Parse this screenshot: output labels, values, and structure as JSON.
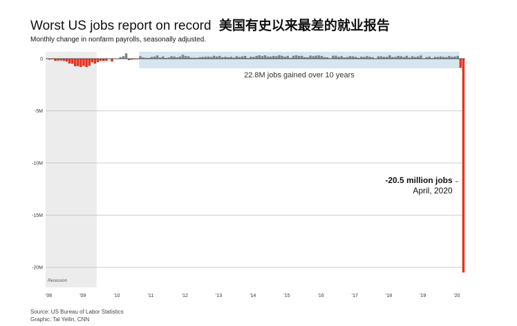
{
  "title": "Worst US jobs report on record",
  "title_cn": "美国有史以来最差的就业报告",
  "subtitle": "Monthly change in nonfarm payrolls, seasonally adjusted.",
  "source": "Source: US Bureau of Labor Statistics",
  "credit": "Graphic: Tal Yellin, CNN",
  "colors": {
    "negative": "#e8321e",
    "positive": "#808689",
    "recession_band": "#ececec",
    "gain_band": "#d6e6ef",
    "grid": "#bdbdbd"
  },
  "chart_data": {
    "type": "bar",
    "x_unit": "month",
    "x_start": "2008-01",
    "x_end": "2020-04",
    "ylabel": "",
    "ylim": [
      -21.0,
      0.6
    ],
    "y_ticks": [
      {
        "value": 0,
        "label": "0"
      },
      {
        "value": -5,
        "label": "-5M"
      },
      {
        "value": -10,
        "label": "-10M"
      },
      {
        "value": -15,
        "label": "-15M"
      },
      {
        "value": -20,
        "label": "-20M"
      }
    ],
    "x_ticks": [
      "'08",
      "'09",
      "'10",
      "'11",
      "'12",
      "'13",
      "'14",
      "'15",
      "'16",
      "'17",
      "'18",
      "'19",
      "'20"
    ],
    "recession": {
      "start": "2008-01",
      "end": "2009-06",
      "label": "Recession"
    },
    "gain_period": {
      "start": "2010-10",
      "end": "2020-02",
      "label": "22.8M jobs gained over 10 years"
    },
    "annotation": {
      "value_label": "-20.5 million jobs",
      "date_label": "April, 2020"
    },
    "values_millions": [
      0.01,
      -0.08,
      -0.05,
      -0.21,
      -0.18,
      -0.17,
      -0.21,
      -0.27,
      -0.46,
      -0.48,
      -0.73,
      -0.71,
      -0.79,
      -0.7,
      -0.8,
      -0.69,
      -0.35,
      -0.47,
      -0.33,
      -0.21,
      -0.22,
      -0.2,
      0.01,
      -0.28,
      0.01,
      -0.02,
      0.15,
      0.25,
      0.52,
      -0.13,
      -0.09,
      -0.06,
      -0.05,
      0.25,
      0.12,
      0.09,
      0.07,
      0.17,
      0.21,
      0.31,
      0.11,
      0.22,
      0.07,
      0.12,
      0.24,
      0.21,
      0.13,
      0.21,
      0.38,
      0.26,
      0.23,
      0.09,
      0.1,
      0.09,
      0.15,
      0.17,
      0.19,
      0.21,
      0.18,
      0.28,
      0.21,
      0.27,
      0.14,
      0.19,
      0.14,
      0.19,
      0.11,
      0.24,
      0.16,
      0.23,
      0.27,
      0.06,
      0.19,
      0.17,
      0.27,
      0.33,
      0.25,
      0.33,
      0.21,
      0.21,
      0.27,
      0.24,
      0.34,
      0.28,
      0.19,
      0.27,
      0.08,
      0.28,
      0.33,
      0.27,
      0.28,
      0.15,
      0.14,
      0.3,
      0.24,
      0.29,
      0.32,
      0.26,
      0.15,
      0.14,
      0.04,
      0.29,
      0.29,
      0.18,
      0.25,
      0.12,
      0.16,
      0.25,
      0.23,
      0.18,
      0.09,
      0.2,
      0.17,
      0.25,
      0.18,
      0.14,
      0.02,
      0.23,
      0.23,
      0.18,
      0.18,
      0.32,
      0.16,
      0.18,
      0.27,
      0.24,
      0.16,
      0.28,
      0.11,
      0.24,
      0.16,
      0.22,
      0.31,
      0.01,
      0.15,
      0.21,
      0.06,
      0.18,
      0.17,
      0.22,
      0.18,
      0.15,
      0.26,
      0.18,
      0.21,
      0.27,
      -0.88,
      -20.5
    ]
  }
}
